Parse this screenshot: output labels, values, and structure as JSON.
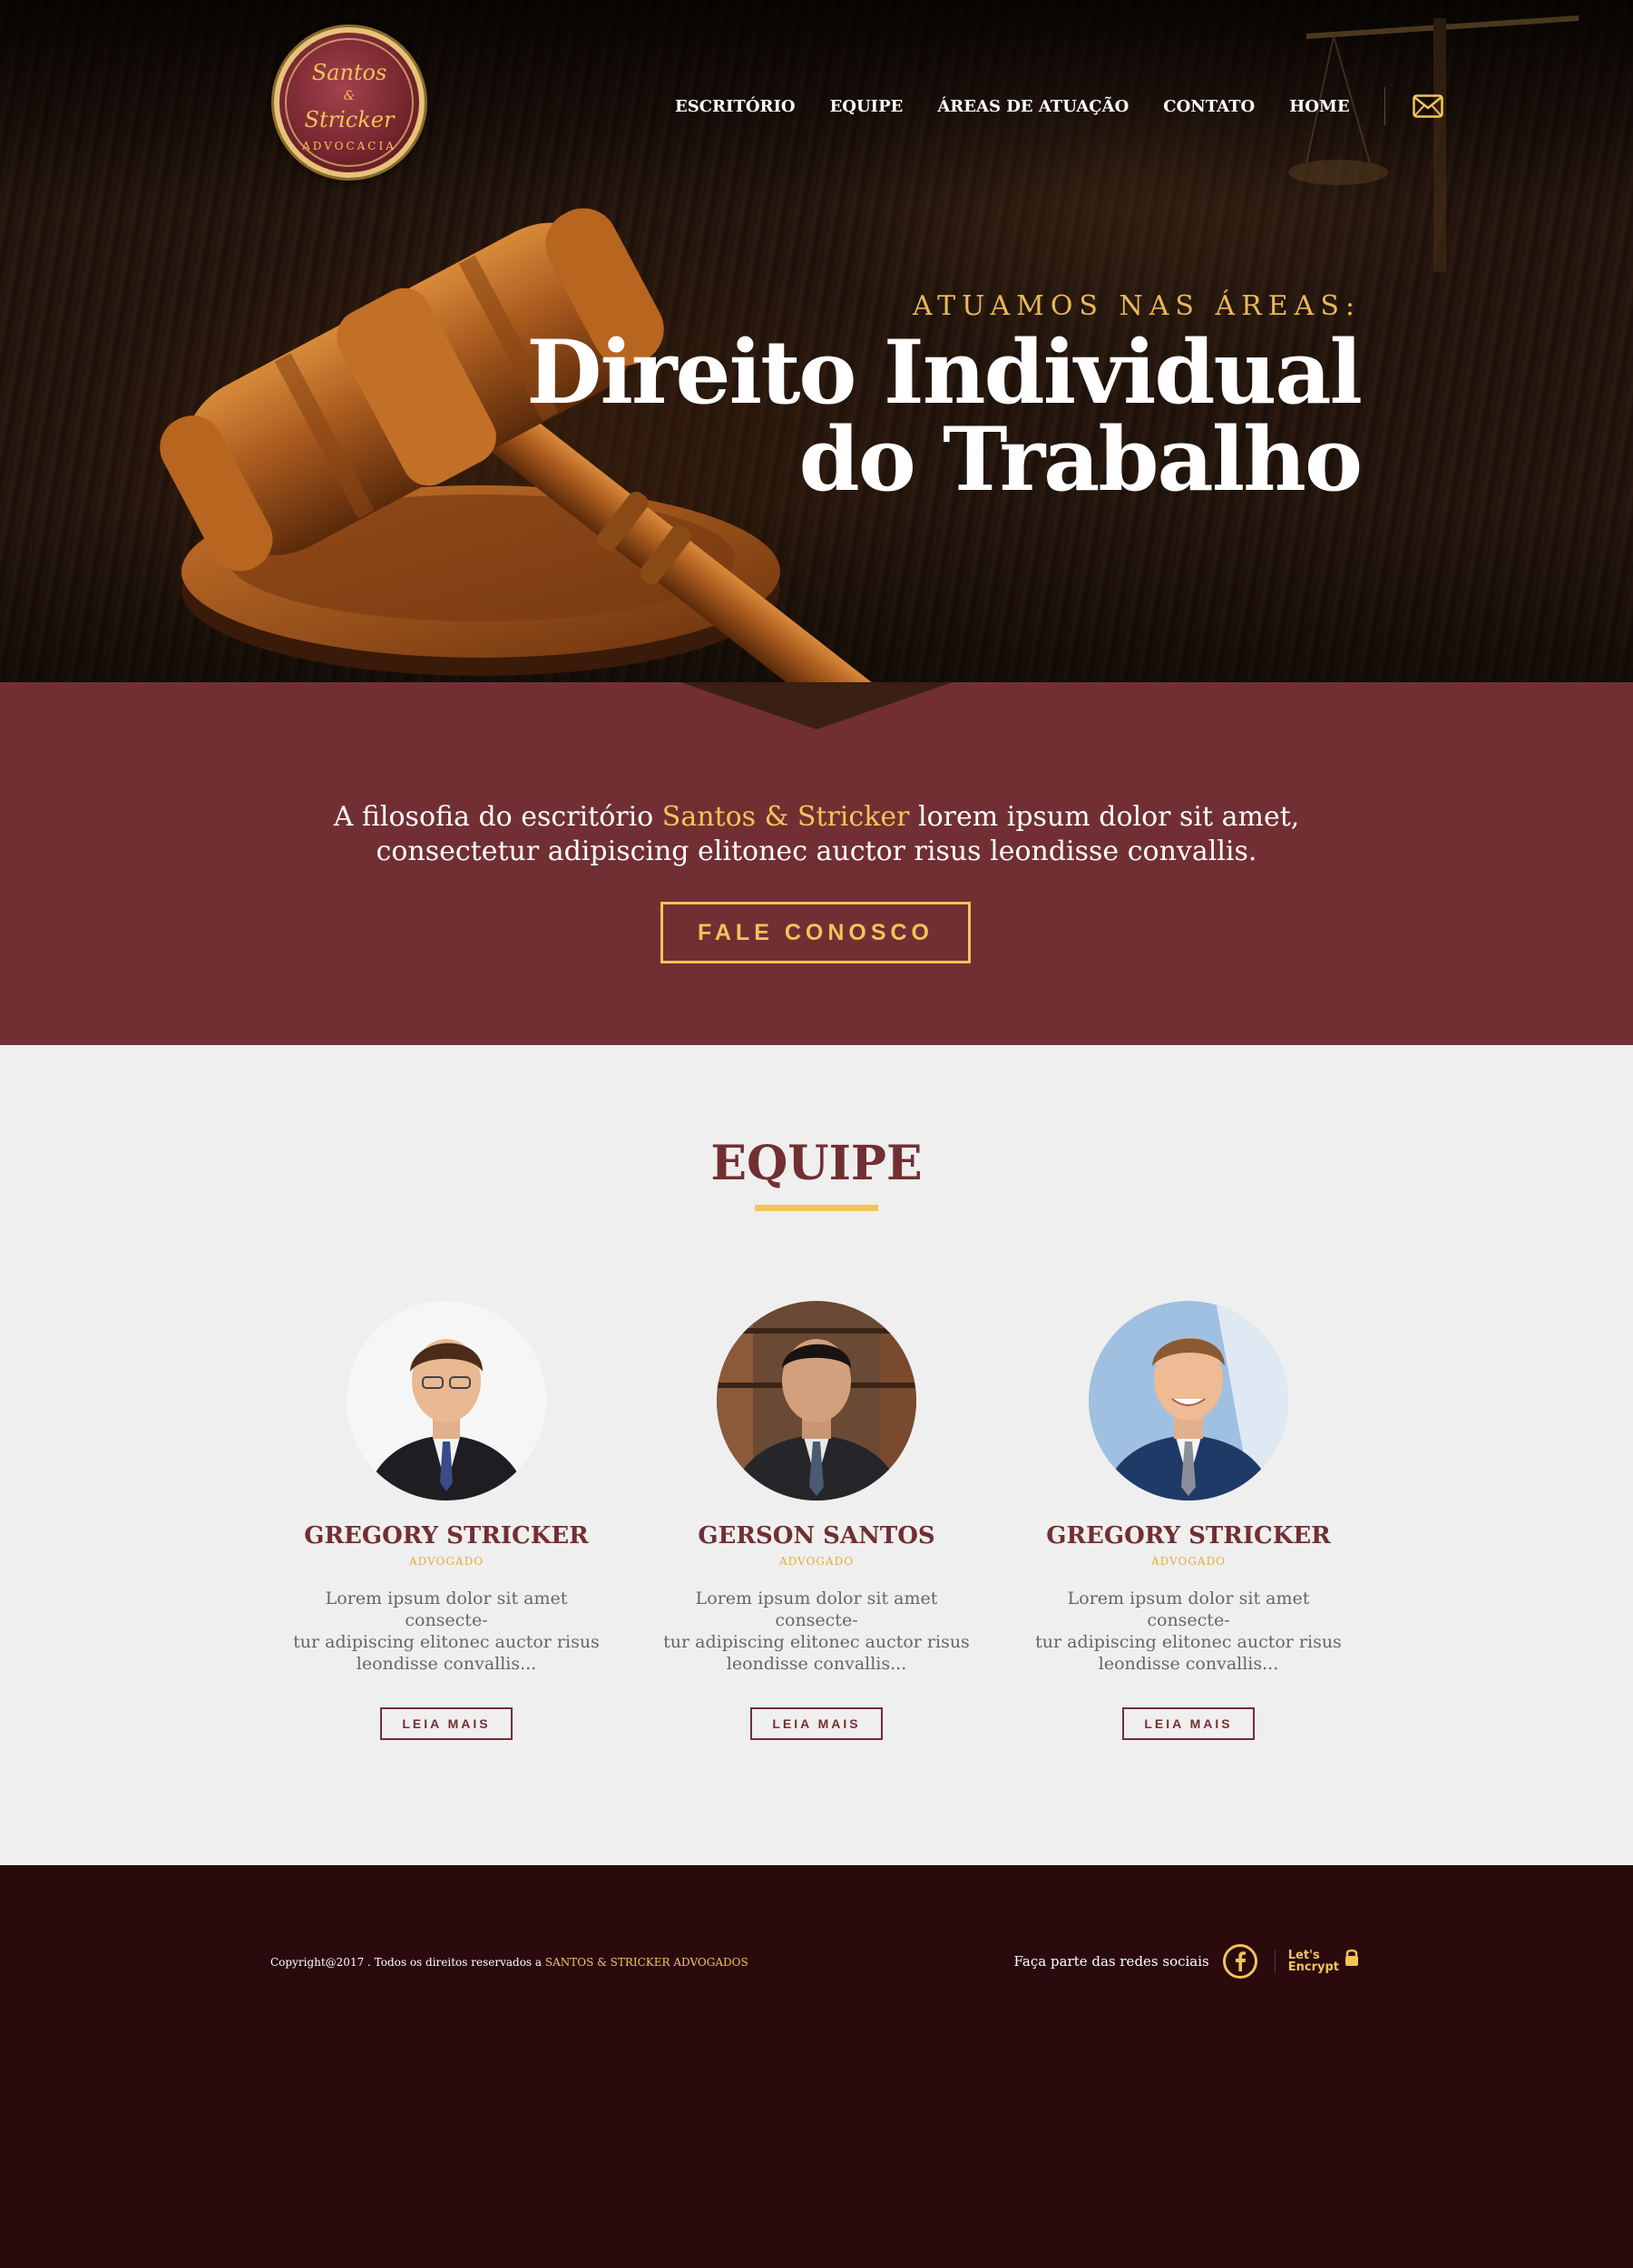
{
  "brand": {
    "logo_line1": "Santos",
    "logo_amp": "&",
    "logo_line2": "Stricker",
    "logo_sub": "ADVOCACIA"
  },
  "nav": {
    "items": [
      "ESCRITÓRIO",
      "EQUIPE",
      "ÁREAS DE ATUAÇÃO",
      "CONTATO",
      "HOME"
    ]
  },
  "hero": {
    "kicker": "ATUAMOS NAS ÁREAS:",
    "title_line1": "Direito Individual",
    "title_line2": "do Trabalho"
  },
  "philosophy": {
    "text_before": "A filosofia do escritório ",
    "highlight": "Santos & Stricker",
    "text_after": " lorem ipsum dolor sit amet,",
    "line2": "consectetur adipiscing elitonec auctor risus leondisse convallis.",
    "cta_label": "FALE CONOSCO"
  },
  "team": {
    "title": "EQUIPE",
    "members": [
      {
        "name": "GREGORY STRICKER",
        "role": "ADVOGADO",
        "desc_line1": "Lorem ipsum dolor sit amet consecte-",
        "desc_line2": "tur adipiscing elitonec auctor risus",
        "desc_line3": "leondisse convallis...",
        "button": "LEIA MAIS"
      },
      {
        "name": "GERSON SANTOS",
        "role": "ADVOGADO",
        "desc_line1": "Lorem ipsum dolor sit amet consecte-",
        "desc_line2": "tur adipiscing elitonec auctor risus",
        "desc_line3": "leondisse convallis...",
        "button": "LEIA MAIS"
      },
      {
        "name": "GREGORY STRICKER",
        "role": "ADVOGADO",
        "desc_line1": "Lorem ipsum dolor sit amet consecte-",
        "desc_line2": "tur adipiscing elitonec auctor risus",
        "desc_line3": "leondisse convallis...",
        "button": "LEIA MAIS"
      }
    ]
  },
  "footer": {
    "copyright_prefix": "Copyright@2017 . Todos os direitos reservados a ",
    "copyright_brand": "SANTOS & STRICKER ADVOGADOS",
    "social_label": "Faça parte das redes sociais",
    "badge_line1": "Let's",
    "badge_line2": "Encrypt"
  },
  "colors": {
    "burgundy": "#722f33",
    "gold": "#f2c45a",
    "footer_bg": "#2a0a0d",
    "team_bg": "#efefef"
  },
  "icons": {
    "mail": "mail-icon",
    "facebook": "facebook-icon",
    "lets_encrypt": "lock-icon"
  }
}
